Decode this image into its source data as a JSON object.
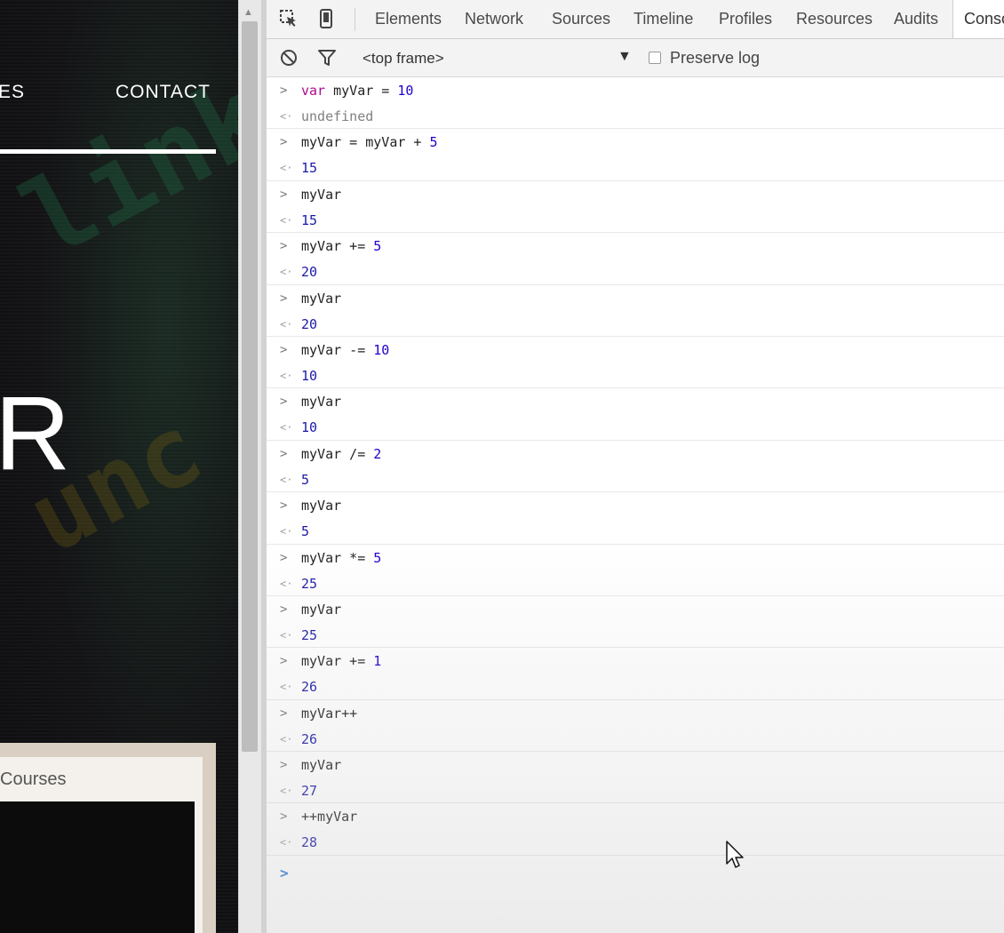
{
  "webpage": {
    "nav_left_fragment": "ES",
    "nav_contact": "CONTACT",
    "hero_fragment": "R",
    "bg_glyph_top": "link",
    "bg_glyph_bottom": "unc",
    "courses_label": "Courses"
  },
  "devtools": {
    "toolbar": {
      "inspect_icon": "inspect-element-icon",
      "device_icon": "device-mode-icon",
      "tabs": [
        "Elements",
        "Network",
        "Sources",
        "Timeline",
        "Profiles",
        "Resources",
        "Audits",
        "Console"
      ],
      "active_tab": "Console"
    },
    "filterbar": {
      "frame": "<top frame>",
      "preserve_log_label": "Preserve log",
      "preserve_log_checked": false
    },
    "console": {
      "entries": [
        {
          "cmd": "var myVar = 10",
          "result": "undefined"
        },
        {
          "cmd": "myVar = myVar + 5",
          "result": "15"
        },
        {
          "cmd": "myVar",
          "result": "15"
        },
        {
          "cmd": "myVar += 5",
          "result": "20"
        },
        {
          "cmd": "myVar",
          "result": "20"
        },
        {
          "cmd": "myVar -= 10",
          "result": "10"
        },
        {
          "cmd": "myVar",
          "result": "10"
        },
        {
          "cmd": "myVar /= 2",
          "result": "5"
        },
        {
          "cmd": "myVar",
          "result": "5"
        },
        {
          "cmd": "myVar *= 5",
          "result": "25"
        },
        {
          "cmd": "myVar",
          "result": "25"
        },
        {
          "cmd": "myVar += 1",
          "result": "26"
        },
        {
          "cmd": "myVar++",
          "result": "26"
        },
        {
          "cmd": "myVar",
          "result": "27"
        },
        {
          "cmd": "++myVar",
          "result": "28"
        }
      ],
      "prompt_glyph": ">",
      "result_glyph": "<·"
    }
  },
  "colors": {
    "keyword": "#aa0d91",
    "number": "#1c00cf",
    "undefined": "#808080",
    "input_prompt": "#2679d6"
  }
}
